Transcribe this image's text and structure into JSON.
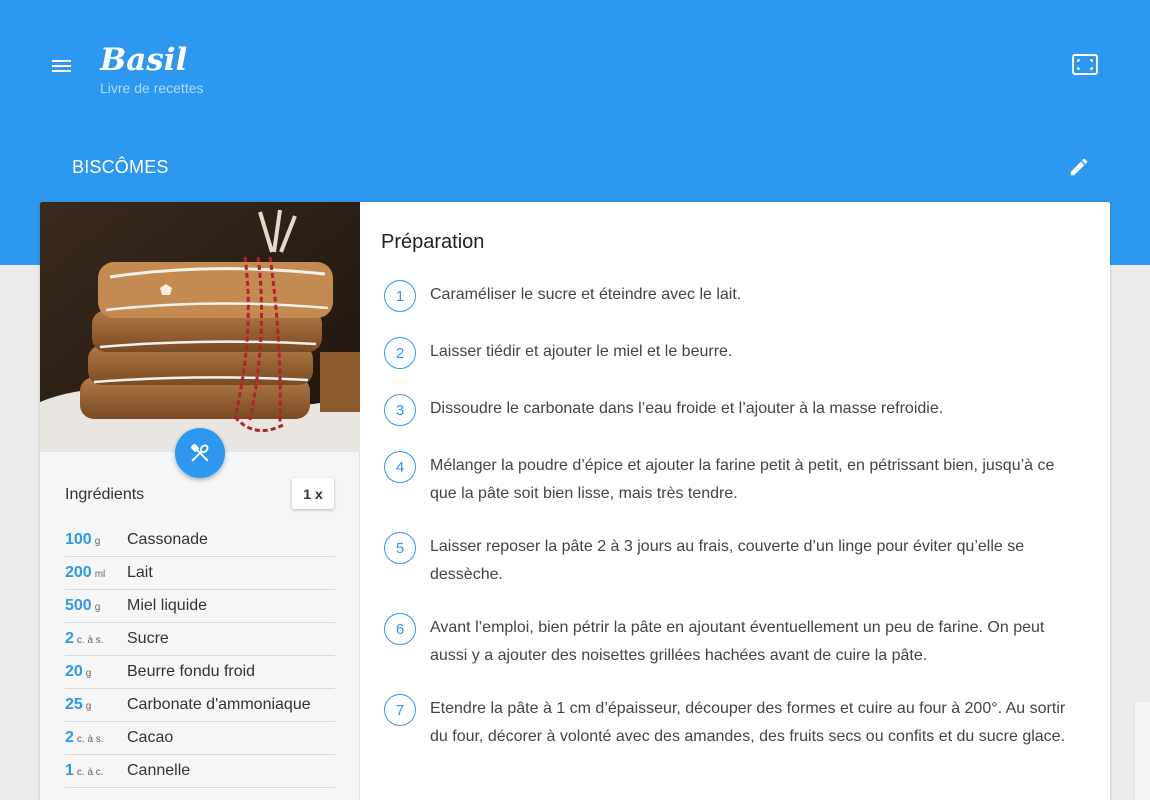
{
  "app": {
    "title": "Basil",
    "subtitle": "Livre de recettes"
  },
  "colors": {
    "primary": "#2c98ef",
    "background": "#ebebeb"
  },
  "icons": {
    "menu": "menu-icon",
    "fullscreen": "fullscreen-icon",
    "edit": "pencil-icon",
    "cook": "utensils-icon"
  },
  "recipe": {
    "title": "BISCÔMES"
  },
  "ingredients": {
    "heading": "Ingrédients",
    "multiplier": "1 x",
    "items": [
      {
        "qty": "100",
        "unit": "g",
        "name": "Cassonade"
      },
      {
        "qty": "200",
        "unit": "ml",
        "name": "Lait"
      },
      {
        "qty": "500",
        "unit": "g",
        "name": "Miel liquide"
      },
      {
        "qty": "2",
        "unit": "c. à s.",
        "name": "Sucre"
      },
      {
        "qty": "20",
        "unit": "g",
        "name": "Beurre fondu froid"
      },
      {
        "qty": "25",
        "unit": "g",
        "name": "Carbonate d'ammoniaque"
      },
      {
        "qty": "2",
        "unit": "c. à s.",
        "name": "Cacao"
      },
      {
        "qty": "1",
        "unit": "c. à c.",
        "name": "Cannelle"
      }
    ]
  },
  "preparation": {
    "heading": "Préparation",
    "steps": [
      {
        "num": "1",
        "text": "Caraméliser le sucre et éteindre avec le lait."
      },
      {
        "num": "2",
        "text": "Laisser tiédir et ajouter le miel et le beurre."
      },
      {
        "num": "3",
        "text": "Dissoudre le carbonate dans l’eau froide et l’ajouter à la masse refroidie."
      },
      {
        "num": "4",
        "text": "Mélanger la poudre d’épice et ajouter la farine petit à petit, en pétrissant bien, jusqu’à ce que la pâte soit bien lisse, mais très tendre."
      },
      {
        "num": "5",
        "text": "Laisser reposer la pâte 2 à 3 jours au frais, couverte d’un linge pour éviter qu’elle se dessèche."
      },
      {
        "num": "6",
        "text": "Avant l’emploi, bien pétrir la pâte en ajoutant éventuellement un peu de farine. On peut aussi y a ajouter des noisettes grillées hachées avant de cuire la pâte."
      },
      {
        "num": "7",
        "text": "Etendre la pâte à 1 cm d’épaisseur, découper des formes et cuire au four à 200°. Au sortir du four, décorer à volonté avec des amandes, des fruits secs ou confits et du sucre glace."
      }
    ]
  }
}
